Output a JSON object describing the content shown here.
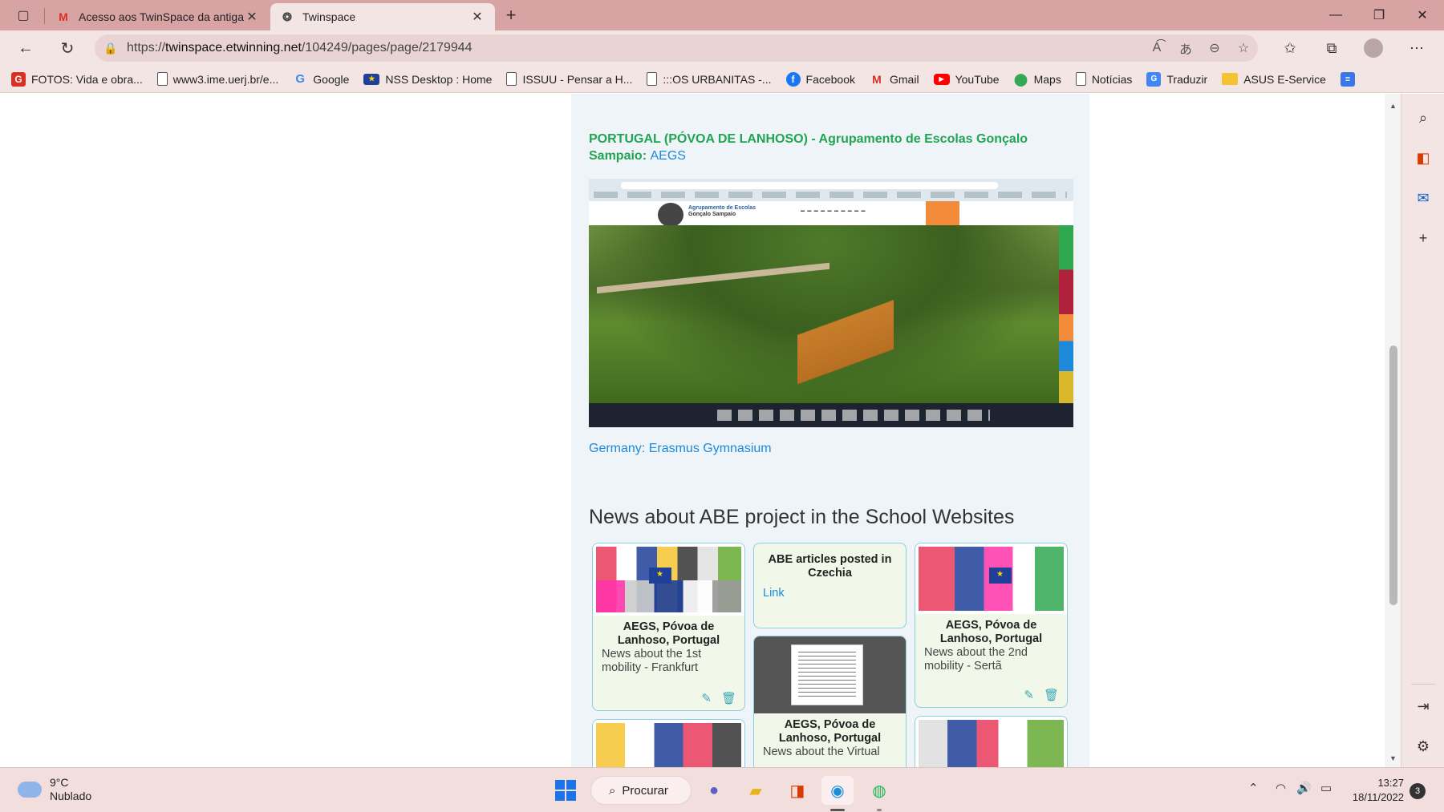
{
  "browser": {
    "tabs": [
      {
        "title": "Acesso aos TwinSpace da antiga",
        "favicon": "gmail-icon",
        "active": false
      },
      {
        "title": "Twinspace",
        "favicon": "twinspace-icon",
        "active": true
      }
    ],
    "url_prefix": "https://",
    "url_host": "twinspace.etwinning.net",
    "url_path": "/104249/pages/page/2179944",
    "favorites": [
      {
        "label": "FOTOS: Vida e obra...",
        "icon": "g-icon"
      },
      {
        "label": "www3.ime.uerj.br/e...",
        "icon": "page-icon"
      },
      {
        "label": "Google",
        "icon": "google-icon"
      },
      {
        "label": "NSS Desktop : Home",
        "icon": "eu-flag-icon"
      },
      {
        "label": "ISSUU - Pensar a H...",
        "icon": "page-icon"
      },
      {
        "label": ":::OS URBANITAS -...",
        "icon": "page-icon"
      },
      {
        "label": "Facebook",
        "icon": "facebook-icon"
      },
      {
        "label": "Gmail",
        "icon": "gmail-icon"
      },
      {
        "label": "YouTube",
        "icon": "youtube-icon"
      },
      {
        "label": "Maps",
        "icon": "maps-icon"
      },
      {
        "label": "Notícias",
        "icon": "page-icon"
      },
      {
        "label": "Traduzir",
        "icon": "translate-icon"
      },
      {
        "label": "ASUS E-Service",
        "icon": "folder-icon"
      }
    ]
  },
  "page": {
    "heading_country": "PORTUGAL (PÓVOA DE LANHOSO) -",
    "heading_school": "Agrupamento de Escolas Gonçalo Sampaio:",
    "heading_abbr": "AEGS",
    "screenshot_site_name_1": "Agrupamento de Escolas",
    "screenshot_site_name_2": "Gonçalo Sampaio",
    "germany_link": "Germany: Erasmus Gymnasium",
    "news_title": "News about ABE project in the School Websites",
    "cards": [
      {
        "title": "AEGS, Póvoa de Lanhoso, Portugal",
        "desc": "News about the 1st mobility - Frankfurt"
      },
      {
        "title": "ABE articles posted in Czechia",
        "link": "Link"
      },
      {
        "title": "AEGS, Póvoa de Lanhoso, Portugal",
        "desc": "News about the 2nd mobility - Sertã"
      },
      {
        "title": "AEGS, Póvoa de Lanhoso, Portugal",
        "desc": "News about the Virtual"
      }
    ]
  },
  "taskbar": {
    "temperature": "9°C",
    "weather": "Nublado",
    "search_label": "Procurar",
    "time": "13:27",
    "date": "18/11/2022",
    "notifications": "3"
  }
}
